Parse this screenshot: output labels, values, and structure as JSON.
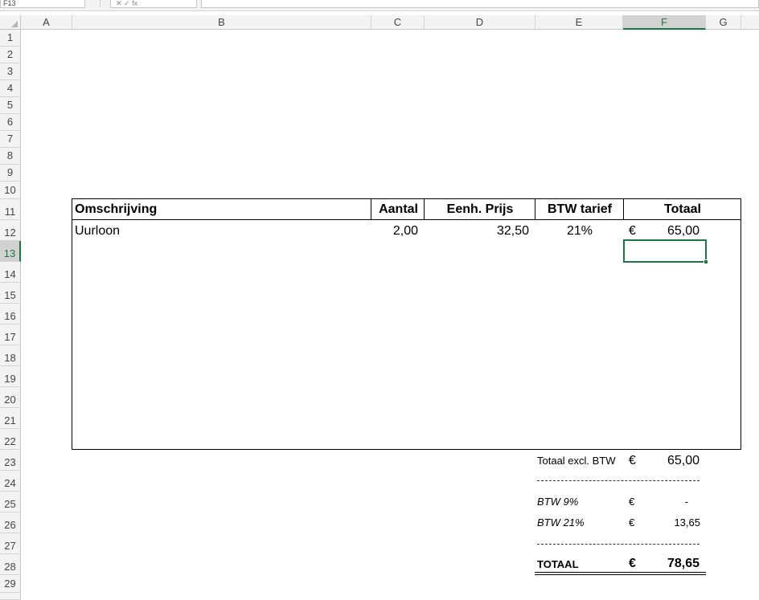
{
  "formula_bar": {
    "name_box": "F13",
    "separator": "⋮",
    "fx_label": "✕ ✓ fx"
  },
  "columns": [
    "A",
    "B",
    "C",
    "D",
    "E",
    "F",
    "G"
  ],
  "rows": [
    "1",
    "2",
    "3",
    "4",
    "5",
    "6",
    "7",
    "8",
    "9",
    "10",
    "11",
    "12",
    "13",
    "14",
    "15",
    "16",
    "17",
    "18",
    "19",
    "20",
    "21",
    "22",
    "23",
    "24",
    "25",
    "26",
    "27",
    "28",
    "29"
  ],
  "active_cell": {
    "column": "F",
    "row": "13"
  },
  "table": {
    "headers": {
      "description": "Omschrijving",
      "quantity": "Aantal",
      "unit_price": "Eenh. Prijs",
      "vat_rate": "BTW tarief",
      "total": "Totaal"
    },
    "rows": [
      {
        "description": "Uurloon",
        "quantity": "2,00",
        "unit_price": "32,50",
        "vat_rate": "21%",
        "currency": "€",
        "total": "65,00"
      }
    ]
  },
  "summary": {
    "subtotal_label": "Totaal excl. BTW",
    "subtotal_currency": "€",
    "subtotal_value": "65,00",
    "vat9_label": "BTW 9%",
    "vat9_currency": "€",
    "vat9_value": "-",
    "vat21_label": "BTW 21%",
    "vat21_currency": "€",
    "vat21_value": "13,65",
    "total_label": "TOTAAL",
    "total_currency": "€",
    "total_value": "78,65"
  },
  "colors": {
    "accent": "#217346",
    "header_bg": "#f3f3f3",
    "grid": "#d4d4d4"
  }
}
